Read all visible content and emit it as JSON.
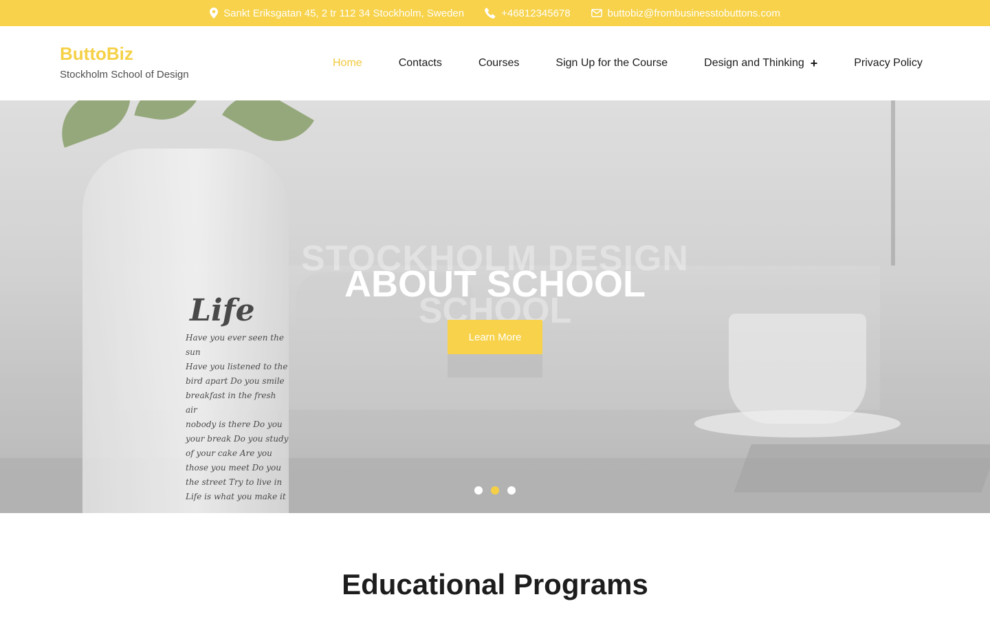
{
  "colors": {
    "accent": "#f7d24a",
    "text": "#1b1b1b"
  },
  "topbar": {
    "address": "Sankt Eriksgatan 45, 2 tr 112 34 Stockholm, Sweden",
    "phone": "+46812345678",
    "email": "buttobiz@frombusinesstobuttons.com",
    "icons": [
      "map-pin-icon",
      "phone-icon",
      "envelope-icon"
    ]
  },
  "brand": {
    "name": "ButtoBiz",
    "tagline": "Stockholm School of Design"
  },
  "nav": {
    "items": [
      {
        "label": "Home",
        "active": true
      },
      {
        "label": "Contacts"
      },
      {
        "label": "Courses"
      },
      {
        "label": "Sign Up for the Course"
      },
      {
        "label": "Design and Thinking",
        "submenu_icon": "plus-icon"
      },
      {
        "label": "Privacy Policy"
      }
    ]
  },
  "hero": {
    "title": "ABOUT SCHOOL",
    "ghost_line1": "STOCKHOLM DESIGN",
    "ghost_line2": "SCHOOL",
    "cta_label": "Learn More",
    "image_text": {
      "life": "Life",
      "lines": [
        "Have you ever seen the sun",
        "Have you listened to the",
        "bird apart Do you smile",
        "breakfast in the fresh air",
        "nobody is there Do you",
        "your break Do you study",
        "of your cake Are you",
        "those you meet Do you",
        "the street Try to live in",
        "Life is what you make it"
      ]
    },
    "slider": {
      "count": 3,
      "active_index": 2
    }
  },
  "main": {
    "section_title": "Educational Programs"
  }
}
